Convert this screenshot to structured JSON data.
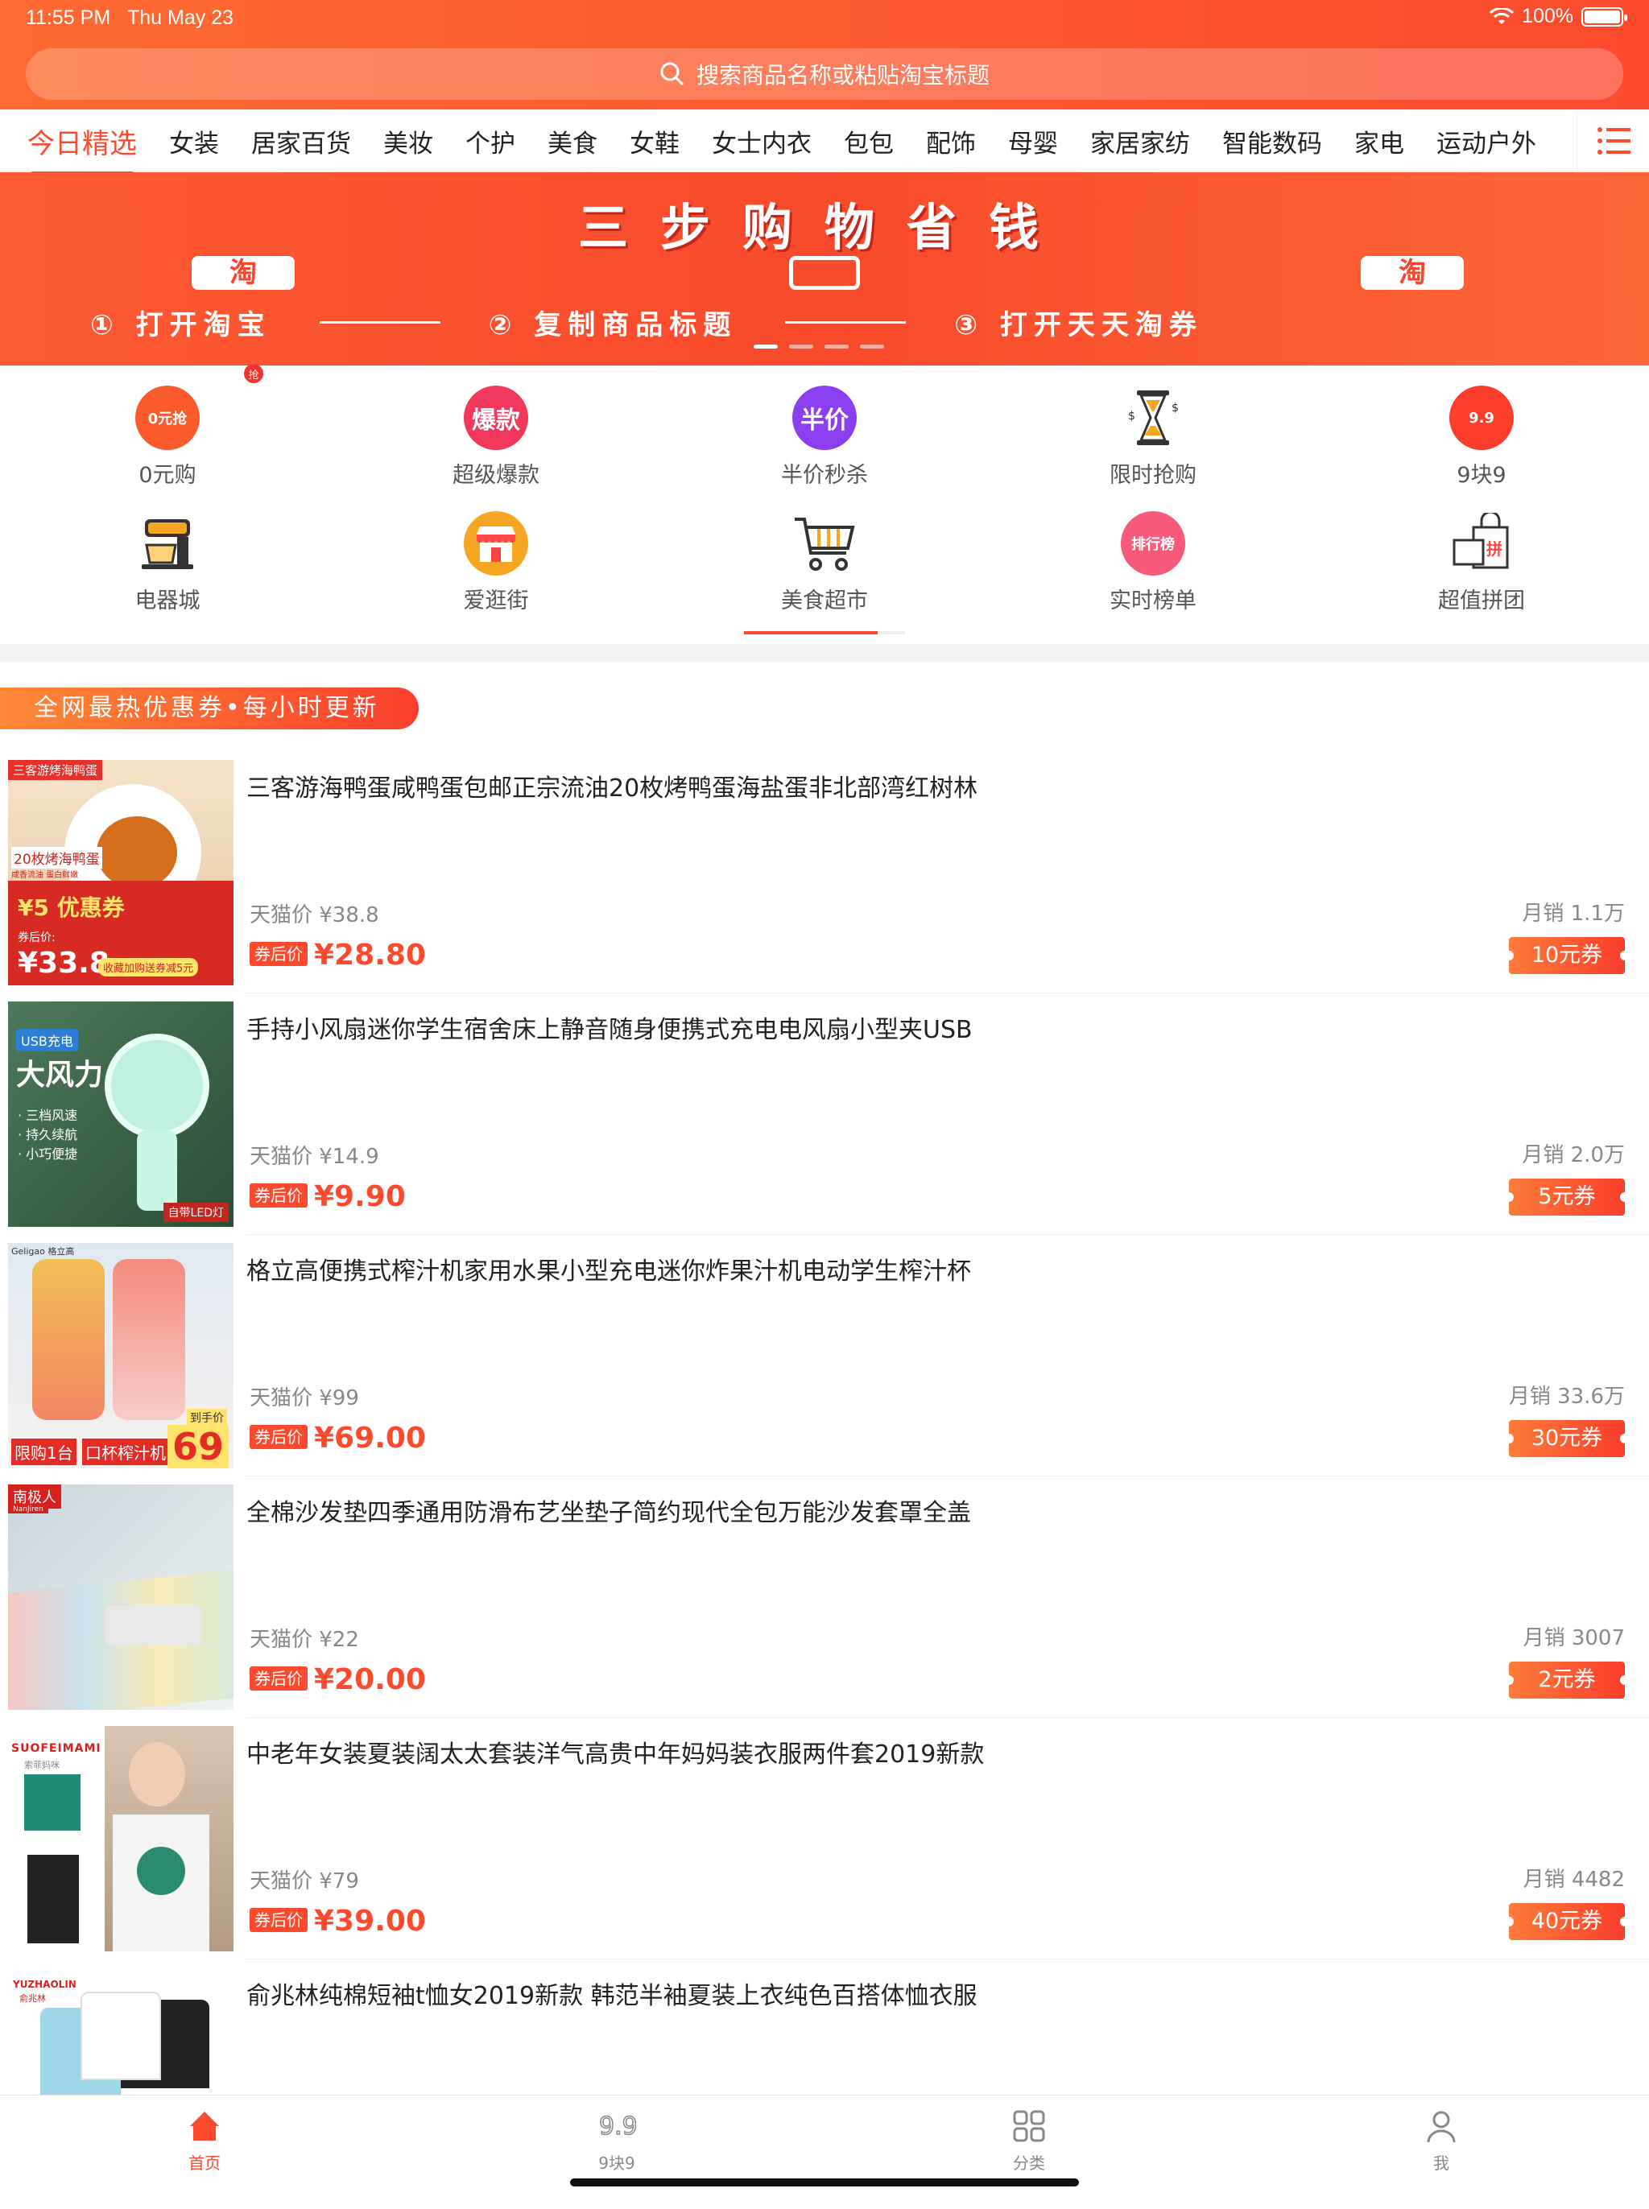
{
  "status": {
    "time": "11:55 PM",
    "date": "Thu May 23",
    "battery": "100%"
  },
  "search": {
    "placeholder": "搜索商品名称或粘贴淘宝标题"
  },
  "nav": {
    "tabs": [
      "今日精选",
      "女装",
      "居家百货",
      "美妆",
      "个护",
      "美食",
      "女鞋",
      "女士内衣",
      "包包",
      "配饰",
      "母婴",
      "家居家纺",
      "智能数码",
      "家电",
      "运动户外"
    ],
    "active": "今日精选"
  },
  "banner": {
    "title": "三步购物省钱",
    "step1": "① 打开淘宝",
    "step2": "② 复制商品标题",
    "step3": "③ 打开天天淘券",
    "taobao_mark": "淘",
    "page_index": 1,
    "page_count": 4
  },
  "icons": [
    {
      "label": "0元购",
      "glyph": "0元抢",
      "badge": "抢",
      "icon": "gift-icon",
      "color": "#fb5a2c"
    },
    {
      "label": "超级爆款",
      "glyph": "爆款",
      "icon": "hot-icon",
      "color": "#f2385a"
    },
    {
      "label": "半价秒杀",
      "glyph": "半价",
      "icon": "half-price-icon",
      "color": "#8a3ff0"
    },
    {
      "label": "限时抢购",
      "icon": "hourglass-icon"
    },
    {
      "label": "9块9",
      "glyph": "9.9",
      "icon": "nine-nine-icon",
      "color": "#fb3e2c"
    },
    {
      "label": "电器城",
      "icon": "mixer-icon"
    },
    {
      "label": "爱逛街",
      "icon": "shop-icon"
    },
    {
      "label": "美食超市",
      "icon": "cart-icon"
    },
    {
      "label": "实时榜单",
      "glyph": "排行榜",
      "icon": "ranking-icon",
      "color": "#f85a7a"
    },
    {
      "label": "超值拼团",
      "glyph": "拼",
      "icon": "group-buy-icon"
    }
  ],
  "hot_bar": "全网最热优惠券•每小时更新",
  "products": [
    {
      "title": "三客游海鸭蛋咸鸭蛋包邮正宗流油20枚烤鸭蛋海盐蛋非北部湾红树林",
      "orig": "天猫价 ¥38.8",
      "coupon_label": "券后价",
      "price": "¥28.80",
      "sales": "月销 1.1万",
      "coupon": "10元券",
      "thumb": {
        "top": "三客游烤海鸭蛋",
        "a": "20枚烤海鸭蛋",
        "b": "咸香流油 蛋白鲜嫩",
        "c": "¥5 优惠券",
        "d": "券后价:",
        "e": "¥33.8",
        "f": "收藏加购送券减5元"
      }
    },
    {
      "title": "手持小风扇迷你学生宿舍床上静音随身便携式充电电风扇小型夹USB",
      "orig": "天猫价 ¥14.9",
      "coupon_label": "券后价",
      "price": "¥9.90",
      "sales": "月销 2.0万",
      "coupon": "5元券",
      "thumb": {
        "a": "USB充电",
        "b": "大风力",
        "c": "· 三档风速",
        "d": "· 持久续航",
        "e": "· 小巧便捷",
        "f": "自带LED灯"
      }
    },
    {
      "title": "格立高便携式榨汁机家用水果小型充电迷你炸果汁机电动学生榨汁杯",
      "orig": "天猫价 ¥99",
      "coupon_label": "券后价",
      "price": "¥69.00",
      "sales": "月销 33.6万",
      "coupon": "30元券",
      "thumb": {
        "a": "Geligao 格立高",
        "b": "限购1台",
        "c": "口杯榨汁机",
        "d": "到手价",
        "e": "69"
      }
    },
    {
      "title": "全棉沙发垫四季通用防滑布艺坐垫子简约现代全包万能沙发套罩全盖",
      "orig": "天猫价 ¥22",
      "coupon_label": "券后价",
      "price": "¥20.00",
      "sales": "月销 3007",
      "coupon": "2元券",
      "thumb": {
        "a": "南极人",
        "b": "NanJiren"
      }
    },
    {
      "title": "中老年女装夏装阔太太套装洋气高贵中年妈妈装衣服两件套2019新款",
      "orig": "天猫价 ¥79",
      "coupon_label": "券后价",
      "price": "¥39.00",
      "sales": "月销 4482",
      "coupon": "40元券",
      "thumb": {
        "a": "SUOFEIMAMI",
        "b": "索菲妈咪"
      }
    },
    {
      "title": "俞兆林纯棉短袖t恤女2019新款 韩范半袖夏装上衣纯色百搭体恤衣服",
      "thumb": {
        "a": "YUZHAOLIN",
        "b": "俞兆林"
      }
    }
  ],
  "tabbar": [
    {
      "label": "首页",
      "icon": "home-icon",
      "active": true
    },
    {
      "label": "9块9",
      "icon": "nine-nine-tab-icon"
    },
    {
      "label": "分类",
      "icon": "category-grid-icon"
    },
    {
      "label": "我",
      "icon": "profile-icon"
    }
  ],
  "colors": {
    "accent": "#fc4a2e",
    "header_start": "#fe6a32",
    "header_end": "#fc4a2e"
  }
}
